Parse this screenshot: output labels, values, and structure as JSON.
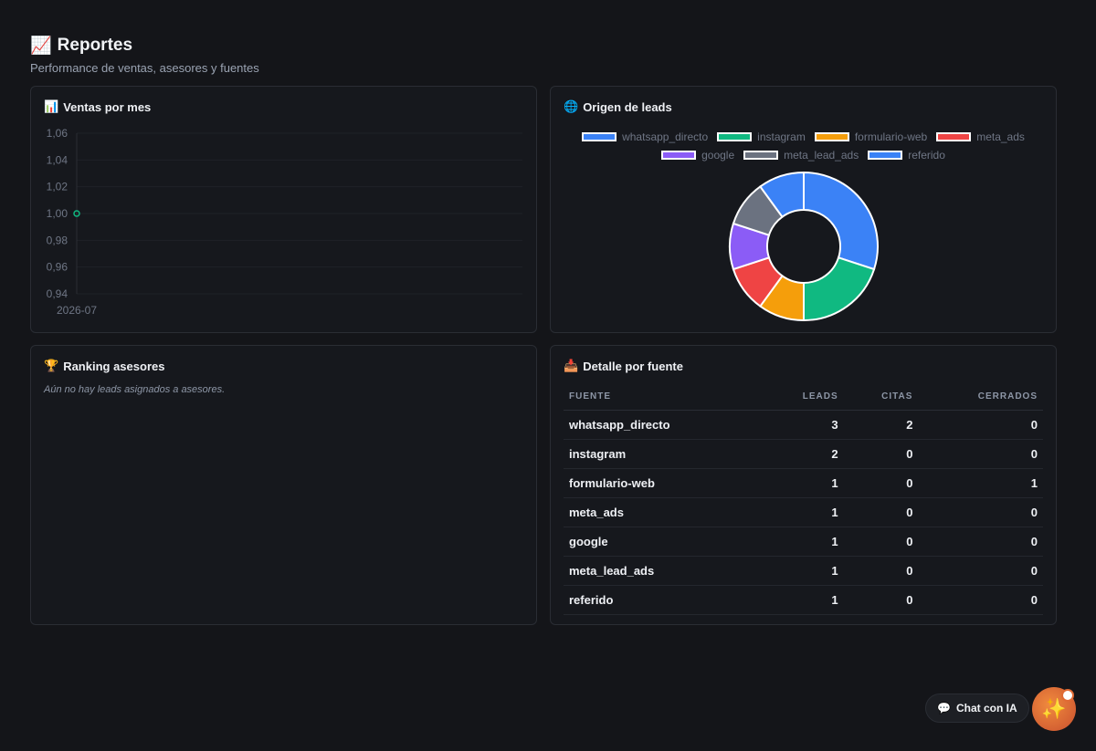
{
  "header": {
    "icon": "📈",
    "title": "Reportes",
    "subtitle": "Performance de ventas, asesores y fuentes"
  },
  "cards": {
    "ventas": {
      "icon": "📊",
      "title": "Ventas por mes"
    },
    "origen": {
      "icon": "🌐",
      "title": "Origen de leads"
    },
    "ranking": {
      "icon": "🏆",
      "title": "Ranking asesores",
      "empty_text": "Aún no hay leads asignados a asesores."
    },
    "detalle": {
      "icon": "📥",
      "title": "Detalle por fuente"
    }
  },
  "chart_data": [
    {
      "type": "line",
      "x": [
        "2026-07"
      ],
      "series": [
        {
          "values": [
            1
          ]
        }
      ],
      "yticks": [
        "1,06",
        "1,04",
        "1,02",
        "1,00",
        "0,98",
        "0,96",
        "0,94"
      ],
      "ylim": [
        0.94,
        1.06
      ],
      "grid": true,
      "color": "#10b981"
    },
    {
      "type": "pie",
      "donut": true,
      "labels": [
        "whatsapp_directo",
        "instagram",
        "formulario-web",
        "meta_ads",
        "google",
        "meta_lead_ads",
        "referido"
      ],
      "values": [
        3,
        2,
        1,
        1,
        1,
        1,
        1
      ],
      "colors": [
        "#3b82f6",
        "#10b981",
        "#f59e0b",
        "#ef4444",
        "#8b5cf6",
        "#6b7280",
        "#3b82f6"
      ],
      "legend": "top"
    }
  ],
  "table": {
    "headers": [
      "FUENTE",
      "LEADS",
      "CITAS",
      "CERRADOS"
    ],
    "rows": [
      [
        "whatsapp_directo",
        "3",
        "2",
        "0"
      ],
      [
        "instagram",
        "2",
        "0",
        "0"
      ],
      [
        "formulario-web",
        "1",
        "0",
        "1"
      ],
      [
        "meta_ads",
        "1",
        "0",
        "0"
      ],
      [
        "google",
        "1",
        "0",
        "0"
      ],
      [
        "meta_lead_ads",
        "1",
        "0",
        "0"
      ],
      [
        "referido",
        "1",
        "0",
        "0"
      ]
    ]
  },
  "chat": {
    "icon": "💬",
    "label": "Chat con IA",
    "fab_icon": "✨"
  }
}
